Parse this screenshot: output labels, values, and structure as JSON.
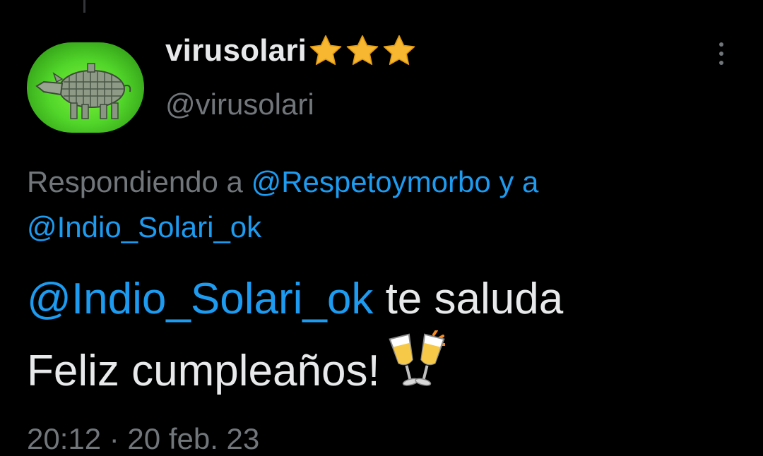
{
  "tweet": {
    "display_name": "virusolari",
    "badge_icons": [
      "star-icon",
      "star-icon",
      "star-icon"
    ],
    "handle": "@virusolari",
    "reply_prefix": "Respondiendo a",
    "reply_mention_1": "@Respetoymorbo",
    "reply_mention_2": "y a",
    "reply_mention_3": "@Indio_Solari_ok",
    "text_mention": "@Indio_Solari_ok",
    "text_line_1_rest": " te saluda",
    "text_line_2": "Feliz cumpleaños!",
    "emoji": "clinking-glasses-emoji",
    "timestamp": "20:12 · 20 feb. 23"
  },
  "colors": {
    "background": "#000000",
    "primary_text": "#e7e9ea",
    "secondary_text": "#71767b",
    "link": "#1d9bf0",
    "star": "#f7b731"
  }
}
